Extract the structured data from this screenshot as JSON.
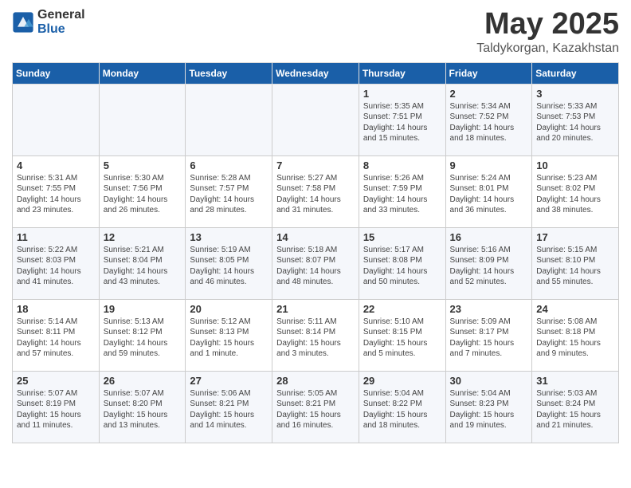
{
  "logo": {
    "general": "General",
    "blue": "Blue"
  },
  "title": "May 2025",
  "subtitle": "Taldykorgan, Kazakhstan",
  "days_of_week": [
    "Sunday",
    "Monday",
    "Tuesday",
    "Wednesday",
    "Thursday",
    "Friday",
    "Saturday"
  ],
  "weeks": [
    [
      {
        "day": "",
        "detail": ""
      },
      {
        "day": "",
        "detail": ""
      },
      {
        "day": "",
        "detail": ""
      },
      {
        "day": "",
        "detail": ""
      },
      {
        "day": "1",
        "detail": "Sunrise: 5:35 AM\nSunset: 7:51 PM\nDaylight: 14 hours\nand 15 minutes."
      },
      {
        "day": "2",
        "detail": "Sunrise: 5:34 AM\nSunset: 7:52 PM\nDaylight: 14 hours\nand 18 minutes."
      },
      {
        "day": "3",
        "detail": "Sunrise: 5:33 AM\nSunset: 7:53 PM\nDaylight: 14 hours\nand 20 minutes."
      }
    ],
    [
      {
        "day": "4",
        "detail": "Sunrise: 5:31 AM\nSunset: 7:55 PM\nDaylight: 14 hours\nand 23 minutes."
      },
      {
        "day": "5",
        "detail": "Sunrise: 5:30 AM\nSunset: 7:56 PM\nDaylight: 14 hours\nand 26 minutes."
      },
      {
        "day": "6",
        "detail": "Sunrise: 5:28 AM\nSunset: 7:57 PM\nDaylight: 14 hours\nand 28 minutes."
      },
      {
        "day": "7",
        "detail": "Sunrise: 5:27 AM\nSunset: 7:58 PM\nDaylight: 14 hours\nand 31 minutes."
      },
      {
        "day": "8",
        "detail": "Sunrise: 5:26 AM\nSunset: 7:59 PM\nDaylight: 14 hours\nand 33 minutes."
      },
      {
        "day": "9",
        "detail": "Sunrise: 5:24 AM\nSunset: 8:01 PM\nDaylight: 14 hours\nand 36 minutes."
      },
      {
        "day": "10",
        "detail": "Sunrise: 5:23 AM\nSunset: 8:02 PM\nDaylight: 14 hours\nand 38 minutes."
      }
    ],
    [
      {
        "day": "11",
        "detail": "Sunrise: 5:22 AM\nSunset: 8:03 PM\nDaylight: 14 hours\nand 41 minutes."
      },
      {
        "day": "12",
        "detail": "Sunrise: 5:21 AM\nSunset: 8:04 PM\nDaylight: 14 hours\nand 43 minutes."
      },
      {
        "day": "13",
        "detail": "Sunrise: 5:19 AM\nSunset: 8:05 PM\nDaylight: 14 hours\nand 46 minutes."
      },
      {
        "day": "14",
        "detail": "Sunrise: 5:18 AM\nSunset: 8:07 PM\nDaylight: 14 hours\nand 48 minutes."
      },
      {
        "day": "15",
        "detail": "Sunrise: 5:17 AM\nSunset: 8:08 PM\nDaylight: 14 hours\nand 50 minutes."
      },
      {
        "day": "16",
        "detail": "Sunrise: 5:16 AM\nSunset: 8:09 PM\nDaylight: 14 hours\nand 52 minutes."
      },
      {
        "day": "17",
        "detail": "Sunrise: 5:15 AM\nSunset: 8:10 PM\nDaylight: 14 hours\nand 55 minutes."
      }
    ],
    [
      {
        "day": "18",
        "detail": "Sunrise: 5:14 AM\nSunset: 8:11 PM\nDaylight: 14 hours\nand 57 minutes."
      },
      {
        "day": "19",
        "detail": "Sunrise: 5:13 AM\nSunset: 8:12 PM\nDaylight: 14 hours\nand 59 minutes."
      },
      {
        "day": "20",
        "detail": "Sunrise: 5:12 AM\nSunset: 8:13 PM\nDaylight: 15 hours\nand 1 minute."
      },
      {
        "day": "21",
        "detail": "Sunrise: 5:11 AM\nSunset: 8:14 PM\nDaylight: 15 hours\nand 3 minutes."
      },
      {
        "day": "22",
        "detail": "Sunrise: 5:10 AM\nSunset: 8:15 PM\nDaylight: 15 hours\nand 5 minutes."
      },
      {
        "day": "23",
        "detail": "Sunrise: 5:09 AM\nSunset: 8:17 PM\nDaylight: 15 hours\nand 7 minutes."
      },
      {
        "day": "24",
        "detail": "Sunrise: 5:08 AM\nSunset: 8:18 PM\nDaylight: 15 hours\nand 9 minutes."
      }
    ],
    [
      {
        "day": "25",
        "detail": "Sunrise: 5:07 AM\nSunset: 8:19 PM\nDaylight: 15 hours\nand 11 minutes."
      },
      {
        "day": "26",
        "detail": "Sunrise: 5:07 AM\nSunset: 8:20 PM\nDaylight: 15 hours\nand 13 minutes."
      },
      {
        "day": "27",
        "detail": "Sunrise: 5:06 AM\nSunset: 8:21 PM\nDaylight: 15 hours\nand 14 minutes."
      },
      {
        "day": "28",
        "detail": "Sunrise: 5:05 AM\nSunset: 8:21 PM\nDaylight: 15 hours\nand 16 minutes."
      },
      {
        "day": "29",
        "detail": "Sunrise: 5:04 AM\nSunset: 8:22 PM\nDaylight: 15 hours\nand 18 minutes."
      },
      {
        "day": "30",
        "detail": "Sunrise: 5:04 AM\nSunset: 8:23 PM\nDaylight: 15 hours\nand 19 minutes."
      },
      {
        "day": "31",
        "detail": "Sunrise: 5:03 AM\nSunset: 8:24 PM\nDaylight: 15 hours\nand 21 minutes."
      }
    ]
  ]
}
